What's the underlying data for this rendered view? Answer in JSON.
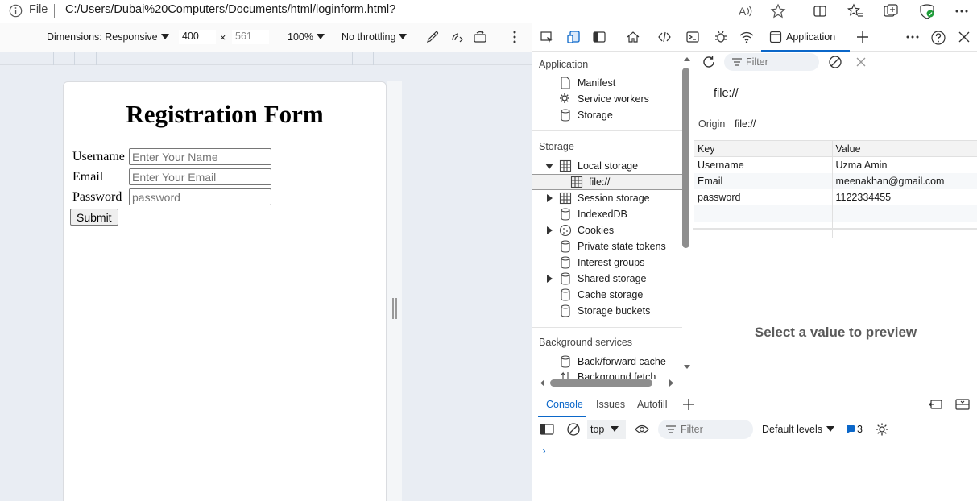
{
  "address_bar": {
    "scheme": "File",
    "url": "C:/Users/Dubai%20Computers/Documents/html/loginform.html?"
  },
  "device_toolbar": {
    "dimensions_label": "Dimensions: Responsive",
    "width": "400",
    "times": "×",
    "height_placeholder": "561",
    "zoom": "100%",
    "throttling": "No throttling"
  },
  "page": {
    "title": "Registration Form",
    "fields": [
      {
        "label": "Username",
        "placeholder": "Enter Your Name"
      },
      {
        "label": "Email",
        "placeholder": "Enter Your Email"
      },
      {
        "label": "Password",
        "placeholder": "password"
      }
    ],
    "submit_label": "Submit"
  },
  "devtools": {
    "active_tab": "Application",
    "sidebar": {
      "section_application": "Application",
      "application_items": [
        "Manifest",
        "Service workers",
        "Storage"
      ],
      "section_storage": "Storage",
      "local_storage": "Local storage",
      "local_storage_child": "file://",
      "session_storage": "Session storage",
      "indexeddb": "IndexedDB",
      "cookies": "Cookies",
      "private_state_tokens": "Private state tokens",
      "interest_groups": "Interest groups",
      "shared_storage": "Shared storage",
      "cache_storage": "Cache storage",
      "storage_buckets": "Storage buckets",
      "section_background": "Background services",
      "back_forward_cache": "Back/forward cache",
      "background_fetch": "Background fetch"
    },
    "filter_placeholder": "Filter",
    "origin_title": "file://",
    "origin_label": "Origin",
    "origin_value": "file://",
    "table": {
      "headers": {
        "key": "Key",
        "value": "Value"
      },
      "rows": [
        {
          "key": "Username",
          "value": "Uzma Amin"
        },
        {
          "key": "Email",
          "value": "meenakhan@gmail.com"
        },
        {
          "key": "password",
          "value": "1122334455"
        }
      ]
    },
    "preview_message": "Select a value to preview",
    "drawer_tabs": [
      "Console",
      "Issues",
      "Autofill"
    ],
    "console": {
      "context": "top",
      "filter_placeholder": "Filter",
      "levels": "Default levels",
      "message_count": "3",
      "prompt": "›"
    }
  },
  "colors": {
    "accent": "#0b67c9",
    "emulation_background": "#e9edf3"
  }
}
